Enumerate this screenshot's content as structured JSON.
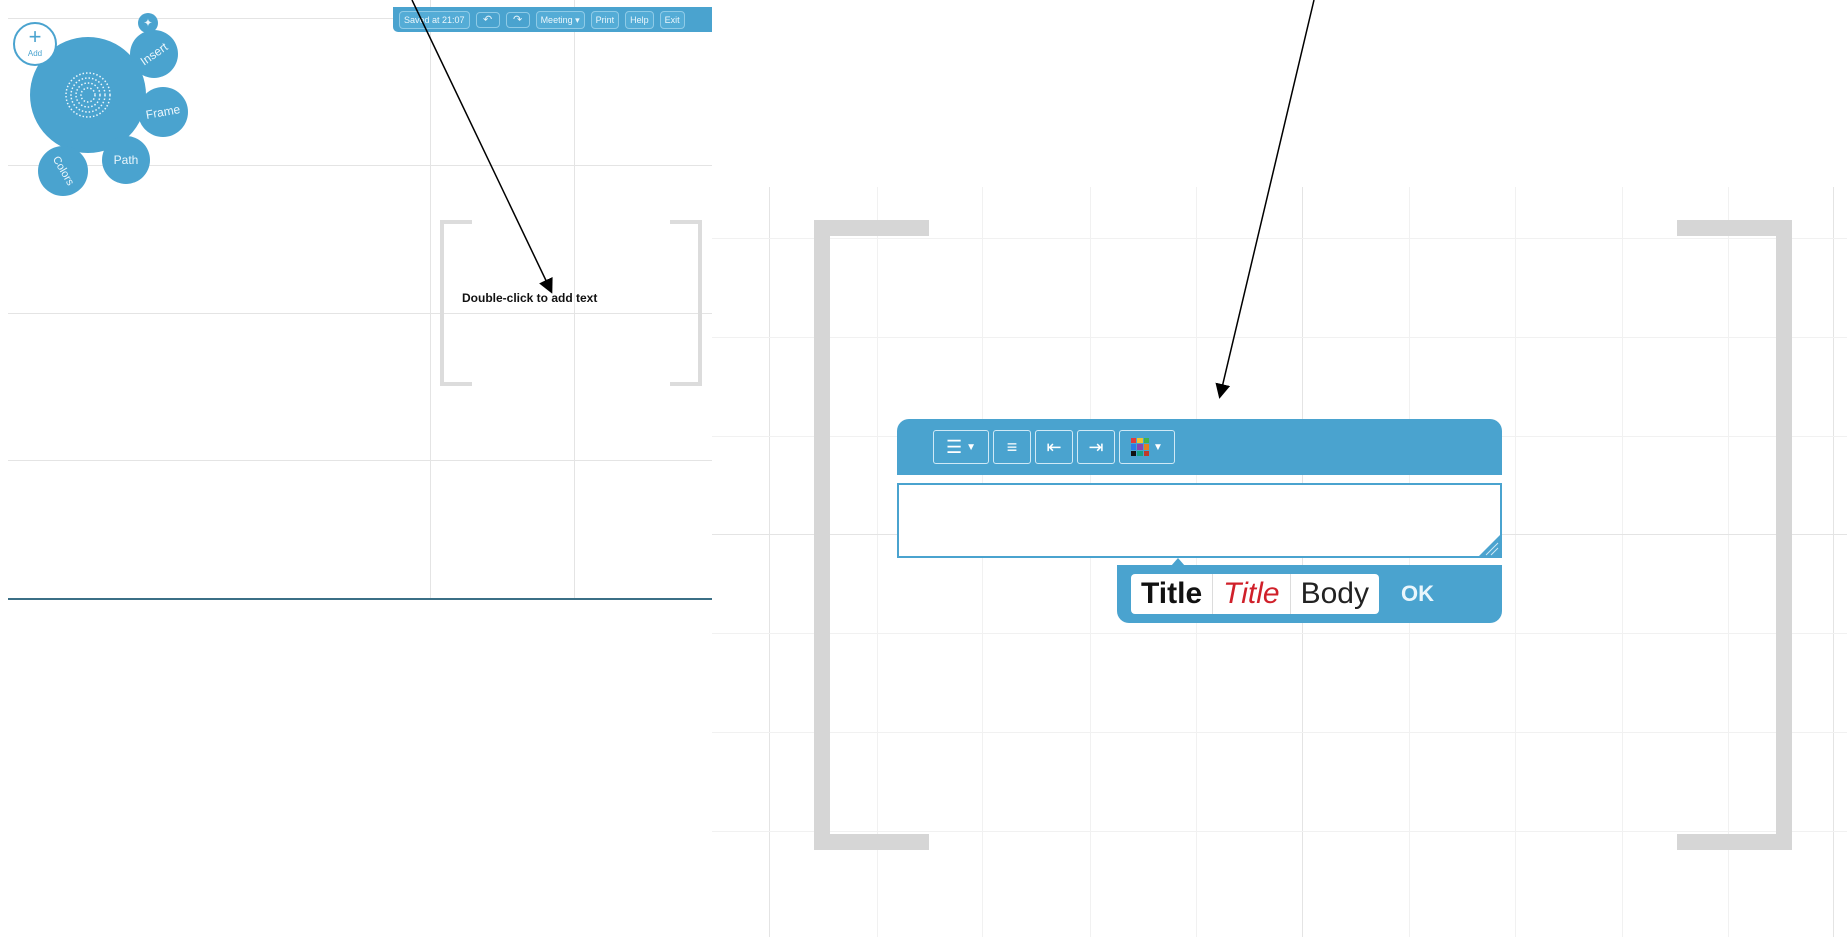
{
  "toolbar": {
    "saved_label": "Saved at 21:07",
    "undo_icon": "undo-icon",
    "redo_icon": "redo-icon",
    "meeting_label": "Meeting",
    "print_label": "Print",
    "help_label": "Help",
    "exit_label": "Exit"
  },
  "zoom_menu": {
    "add_symbol": "+",
    "add_label": "Add",
    "insert_label": "Insert",
    "frame_label": "Frame",
    "path_label": "Path",
    "colors_label": "Colors"
  },
  "canvas": {
    "hint_text": "Double-click to add text"
  },
  "editor": {
    "input_value": "",
    "styles": {
      "title_bold": "Title",
      "title_red": "Title",
      "body": "Body"
    },
    "ok_label": "OK"
  },
  "colors": {
    "accent": "#4aa3cf",
    "frame_bracket": "#d6d6d6",
    "title_red": "#d0202a"
  }
}
